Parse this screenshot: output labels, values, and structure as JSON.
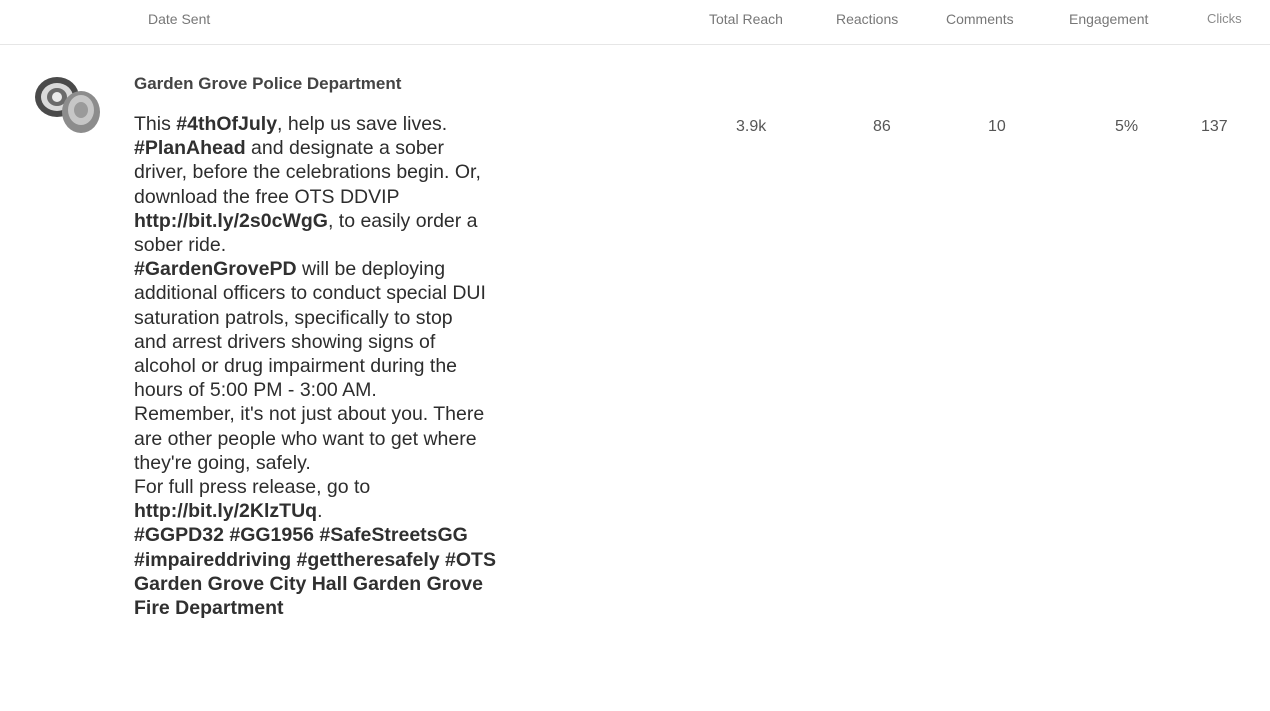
{
  "columns": {
    "date_sent": "Date Sent",
    "total_reach": "Total Reach",
    "reactions": "Reactions",
    "comments": "Comments",
    "engagement": "Engagement",
    "clicks": "Clicks"
  },
  "post": {
    "page_name": "Garden Grove Police Department",
    "avatar_icon": "police-badge-icon",
    "lines": [
      [
        {
          "t": "This "
        },
        {
          "t": "#4thOfJuly",
          "b": true
        },
        {
          "t": ", help us save lives."
        }
      ],
      [
        {
          "t": "#PlanAhead",
          "b": true
        },
        {
          "t": " and designate a sober"
        }
      ],
      [
        {
          "t": "driver, before the celebrations begin. Or,"
        }
      ],
      [
        {
          "t": "download the free OTS DDVIP"
        }
      ],
      [
        {
          "t": "http://bit.ly/2s0cWgG",
          "b": true
        },
        {
          "t": ", to easily order a"
        }
      ],
      [
        {
          "t": "sober ride."
        }
      ],
      [
        {
          "t": "#GardenGrovePD",
          "b": true
        },
        {
          "t": " will be deploying"
        }
      ],
      [
        {
          "t": "additional officers to conduct special DUI"
        }
      ],
      [
        {
          "t": "saturation patrols, specifically to stop"
        }
      ],
      [
        {
          "t": "and arrest drivers showing signs of"
        }
      ],
      [
        {
          "t": "alcohol or drug impairment during the"
        }
      ],
      [
        {
          "t": "hours of 5:00 PM - 3:00 AM."
        }
      ],
      [
        {
          "t": "Remember, it's not just about you. There"
        }
      ],
      [
        {
          "t": "are other people who want to get where"
        }
      ],
      [
        {
          "t": "they're going, safely."
        }
      ],
      [
        {
          "t": "For full press release, go to"
        }
      ],
      [
        {
          "t": "http://bit.ly/2KlzTUq",
          "b": true
        },
        {
          "t": "."
        }
      ],
      [
        {
          "t": "#GGPD32 #GG1956 #SafeStreetsGG",
          "b": true
        }
      ],
      [
        {
          "t": "#impaireddriving #gettheresafely #OTS",
          "b": true
        }
      ],
      [
        {
          "t": "Garden Grove City Hall Garden Grove",
          "b": true
        }
      ],
      [
        {
          "t": "Fire Department",
          "b": true
        }
      ]
    ],
    "metrics": {
      "total_reach": "3.9k",
      "reactions": "86",
      "comments": "10",
      "engagement": "5%",
      "clicks": "137"
    }
  }
}
